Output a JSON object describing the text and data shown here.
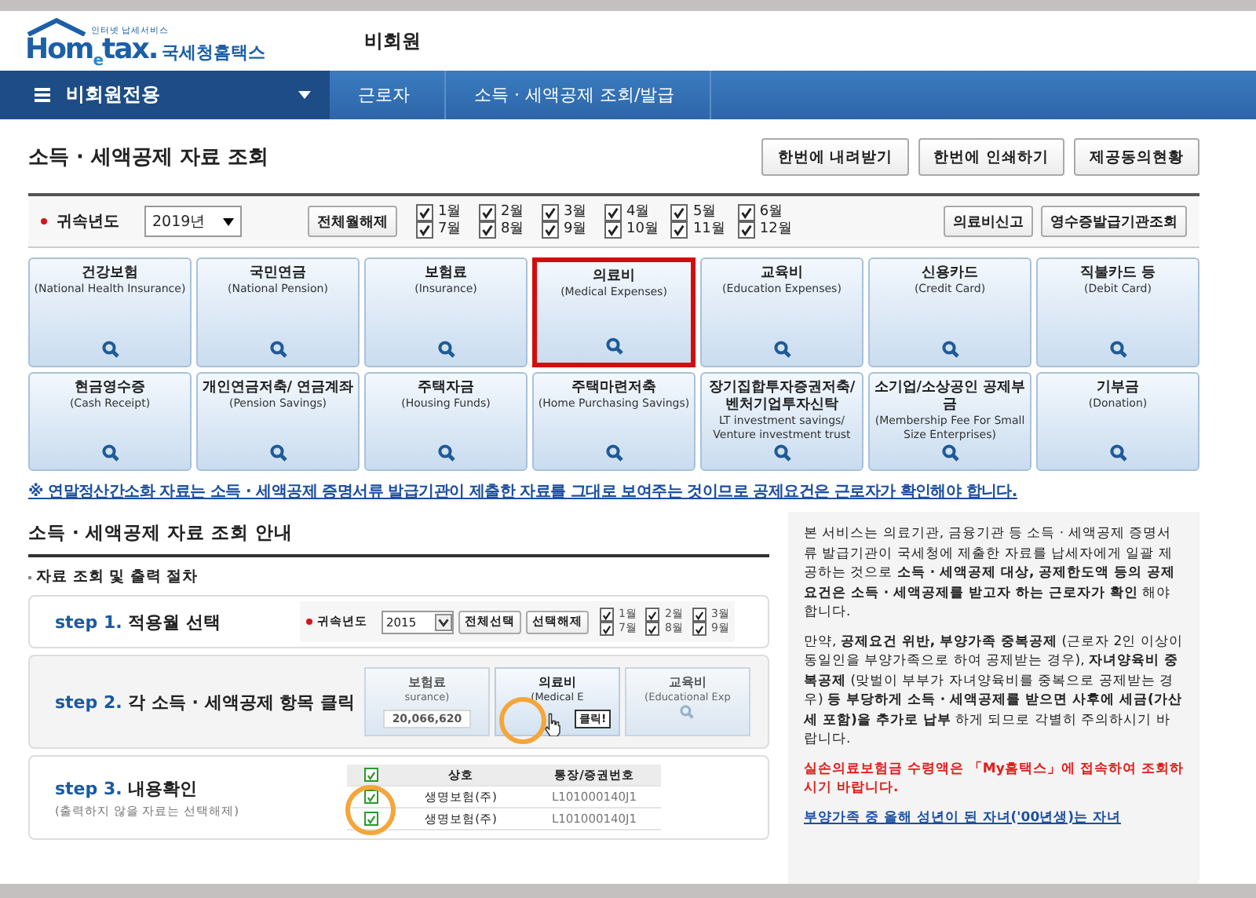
{
  "logo": {
    "tagline": "인터넷 납세서비스",
    "brand": "Hom$_{e}$tax.",
    "name": "국세청홈택스"
  },
  "header_label": "비회원",
  "nav": {
    "menu": "비회원전용",
    "breadcrumbs": [
      "근로자",
      "소득 · 세액공제 조회/발급"
    ]
  },
  "title": "소득 · 세액공제 자료 조회",
  "top_buttons": [
    "한번에 내려받기",
    "한번에 인쇄하기",
    "제공동의현황"
  ],
  "filter": {
    "label": "귀속년도",
    "year": "2019년",
    "clear_button": "전체월해제",
    "months": [
      {
        "label": "1월",
        "checked": true
      },
      {
        "label": "7월",
        "checked": true
      },
      {
        "label": "2월",
        "checked": true
      },
      {
        "label": "8월",
        "checked": true
      },
      {
        "label": "3월",
        "checked": true
      },
      {
        "label": "9월",
        "checked": true
      },
      {
        "label": "4월",
        "checked": true
      },
      {
        "label": "10월",
        "checked": true
      },
      {
        "label": "5월",
        "checked": true
      },
      {
        "label": "11월",
        "checked": true
      },
      {
        "label": "6월",
        "checked": true
      },
      {
        "label": "12월",
        "checked": true
      }
    ],
    "right_buttons": [
      "의료비신고",
      "영수증발급기관조회"
    ]
  },
  "categories": [
    {
      "name": "건강보험",
      "english": "(National Health Insurance)",
      "selected": false
    },
    {
      "name": "국민연금",
      "english": "(National Pension)",
      "selected": false
    },
    {
      "name": "보험료",
      "english": "(Insurance)",
      "selected": false
    },
    {
      "name": "의료비",
      "english": "(Medical Expenses)",
      "selected": true
    },
    {
      "name": "교육비",
      "english": "(Education Expenses)",
      "selected": false
    },
    {
      "name": "신용카드",
      "english": "(Credit Card)",
      "selected": false
    },
    {
      "name": "직불카드 등",
      "english": "(Debit Card)",
      "selected": false
    },
    {
      "name": "현금영수증",
      "english": "(Cash Receipt)",
      "selected": false
    },
    {
      "name": "개인연금저축/ 연금계좌",
      "english": "(Pension Savings)",
      "selected": false
    },
    {
      "name": "주택자금",
      "english": "(Housing Funds)",
      "selected": false
    },
    {
      "name": "주택마련저축",
      "english": "(Home Purchasing Savings)",
      "selected": false
    },
    {
      "name": "장기집합투자증권저축/ 벤처기업투자신탁",
      "english": "LT investment savings/ Venture investment trust",
      "selected": false
    },
    {
      "name": "소기업/소상공인 공제부금",
      "english": "(Membership Fee For Small Size Enterprises)",
      "selected": false
    },
    {
      "name": "기부금",
      "english": "(Donation)",
      "selected": false
    }
  ],
  "notice": "※ 연말정산간소화 자료는 소득 · 세액공제 증명서류 발급기관이 제출한 자료를 그대로 보여주는 것이므로 공제요건은 근로자가 확인해야 합니다.",
  "guide": {
    "title": "소득 · 세액공제 자료 조회 안내",
    "subtitle": "자료 조회 및 출력 절차",
    "steps": [
      {
        "kind": "months",
        "number": "step 1.",
        "title": "적용월 선택"
      },
      {
        "kind": "cards",
        "number": "step 2.",
        "title": "각 소득 · 세액공제 항목 클릭"
      },
      {
        "kind": "table",
        "number": "step 3.",
        "title": "내용확인",
        "note": "(출력하지 않을 자료는 선택해제)"
      }
    ],
    "step1_demo": {
      "label": "귀속년도",
      "year": "2015",
      "buttons": [
        "전체선택",
        "선택해제"
      ],
      "months": [
        {
          "label": "1월",
          "checked": true
        },
        {
          "label": "7월",
          "checked": true
        },
        {
          "label": "2월",
          "checked": true
        },
        {
          "label": "8월",
          "checked": true
        },
        {
          "label": "3월",
          "checked": true
        },
        {
          "label": "9월",
          "checked": true
        }
      ]
    },
    "step2_demo": {
      "left_name": "보험료",
      "left_english": "surance)",
      "amount": "20,066,620",
      "middle_name": "의료비",
      "middle_english": "(Medical E",
      "callout": "클릭!",
      "right_name": "교육비",
      "right_english": "(Educational Exp"
    },
    "step3_demo": {
      "columns": [
        "상호",
        "통장/증권번호"
      ],
      "header_checked": true,
      "rows": [
        {
          "name": "생명보험(주)",
          "account": "L101000140J1",
          "checked": true
        },
        {
          "name": "생명보험(주)",
          "account": "L101000140J1",
          "checked": true
        }
      ]
    }
  },
  "info": [
    {
      "kind": "plain",
      "text": "본 서비스는 의료기관, 금융기관 등 소득 · 세액공제 증명서류 발급기관이 국세청에 제출한 자료를 납세자에게 일괄 제공하는 것으로 **소득 · 세액공제 대상, 공제한도액 등의 공제요건은 소득 · 세액공제를 받고자 하는 근로자가 확인** 해야 합니다."
    },
    {
      "kind": "plain",
      "text": "만약, **공제요건 위반, 부양가족 중복공제** (근로자 2인 이상이 동일인을 부양가족으로 하여 공제받는 경우), **자녀양육비 중복공제** (맞벌이 부부가 자녀양육비를 중복으로 공제받는 경우) **등 부당하게 소득 · 세액공제를 받으면 사후에 세금(가산세 포함)을 추가로 납부** 하게 되므로 각별히 주의하시기 바랍니다."
    },
    {
      "kind": "warning",
      "text": "실손의료보험금 수령액은 「My홈택스」에 접속하여 조회하시기 바랍니다."
    },
    {
      "kind": "link",
      "text": "부양가족 중 올해 성년이 된 자녀('00년생)는 자녀"
    }
  ]
}
